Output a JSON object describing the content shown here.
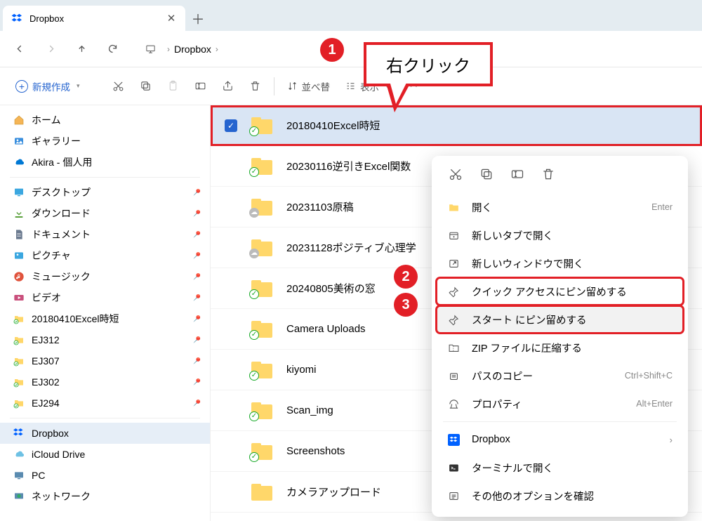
{
  "tab": {
    "title": "Dropbox"
  },
  "breadcrumb": {
    "root": "Dropbox"
  },
  "toolbar": {
    "new_label": "新規作成",
    "sort_label": "並べ替",
    "view_label": "表示"
  },
  "sidebar": {
    "top": [
      {
        "label": "ホーム",
        "icon": "home"
      },
      {
        "label": "ギャラリー",
        "icon": "gallery"
      },
      {
        "label": "Akira - 個人用",
        "icon": "onedrive"
      }
    ],
    "pinned": [
      {
        "label": "デスクトップ",
        "icon": "desktop"
      },
      {
        "label": "ダウンロード",
        "icon": "downloads"
      },
      {
        "label": "ドキュメント",
        "icon": "documents"
      },
      {
        "label": "ピクチャ",
        "icon": "pictures"
      },
      {
        "label": "ミュージック",
        "icon": "music"
      },
      {
        "label": "ビデオ",
        "icon": "videos"
      },
      {
        "label": "20180410Excel時短",
        "icon": "folder-green"
      },
      {
        "label": "EJ312",
        "icon": "folder-green"
      },
      {
        "label": "EJ307",
        "icon": "folder-green"
      },
      {
        "label": "EJ302",
        "icon": "folder-green"
      },
      {
        "label": "EJ294",
        "icon": "folder-green"
      }
    ],
    "bottom": [
      {
        "label": "Dropbox",
        "icon": "dropbox",
        "active": true
      },
      {
        "label": "iCloud Drive",
        "icon": "icloud"
      },
      {
        "label": "PC",
        "icon": "pc"
      },
      {
        "label": "ネットワーク",
        "icon": "network"
      }
    ]
  },
  "files": [
    {
      "name": "20180410Excel時短",
      "overlay": "green",
      "selected": true
    },
    {
      "name": "20230116逆引きExcel関数",
      "overlay": "green"
    },
    {
      "name": "20231103原稿",
      "overlay": "gray"
    },
    {
      "name": "20231128ポジティブ心理学",
      "overlay": "gray"
    },
    {
      "name": "20240805美術の窓",
      "overlay": "green"
    },
    {
      "name": "Camera Uploads",
      "overlay": "green"
    },
    {
      "name": "kiyomi",
      "overlay": "green"
    },
    {
      "name": "Scan_img",
      "overlay": "green"
    },
    {
      "name": "Screenshots",
      "overlay": "green"
    },
    {
      "name": "カメラアップロード",
      "overlay": ""
    }
  ],
  "context_menu": {
    "items": [
      {
        "label": "開く",
        "icon": "folder",
        "shortcut": "Enter"
      },
      {
        "label": "新しいタブで開く",
        "icon": "newtab"
      },
      {
        "label": "新しいウィンドウで開く",
        "icon": "newwindow"
      },
      {
        "label": "クイック アクセスにピン留めする",
        "icon": "pin",
        "hl": true
      },
      {
        "label": "スタート にピン留めする",
        "icon": "pin",
        "hl": true,
        "sel": true
      },
      {
        "label": "ZIP ファイルに圧縮する",
        "icon": "zip"
      },
      {
        "label": "パスのコピー",
        "icon": "copypath",
        "shortcut": "Ctrl+Shift+C"
      },
      {
        "label": "プロパティ",
        "icon": "properties",
        "shortcut": "Alt+Enter"
      }
    ],
    "group2": [
      {
        "label": "Dropbox",
        "icon": "dropbox",
        "arrow": true
      },
      {
        "label": "ターミナルで開く",
        "icon": "terminal"
      },
      {
        "label": "その他のオプションを確認",
        "icon": "more"
      }
    ]
  },
  "annotation": {
    "bubble": "右クリック",
    "n1": "1",
    "n2": "2",
    "n3": "3"
  }
}
